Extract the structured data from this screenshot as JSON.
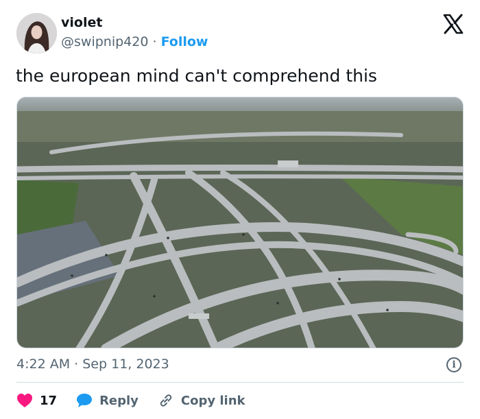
{
  "author": {
    "name": "violet",
    "handle": "@swipnip420",
    "separator": "·",
    "follow_label": "Follow"
  },
  "tweet": {
    "text": "the european mind can't comprehend this",
    "time": "4:22 AM",
    "date": "Sep 11, 2023",
    "separator": "·"
  },
  "actions": {
    "like_count": "17",
    "reply_label": "Reply",
    "copy_link_label": "Copy link"
  },
  "icons": {
    "like": "heart-icon",
    "reply": "speech-bubble-icon",
    "copy": "link-icon",
    "logo": "x-logo-icon",
    "info": "info-icon"
  },
  "colors": {
    "link": "#1d9bf0",
    "secondary": "#536471",
    "heart": "#f91880",
    "divider": "#cfd9de"
  }
}
